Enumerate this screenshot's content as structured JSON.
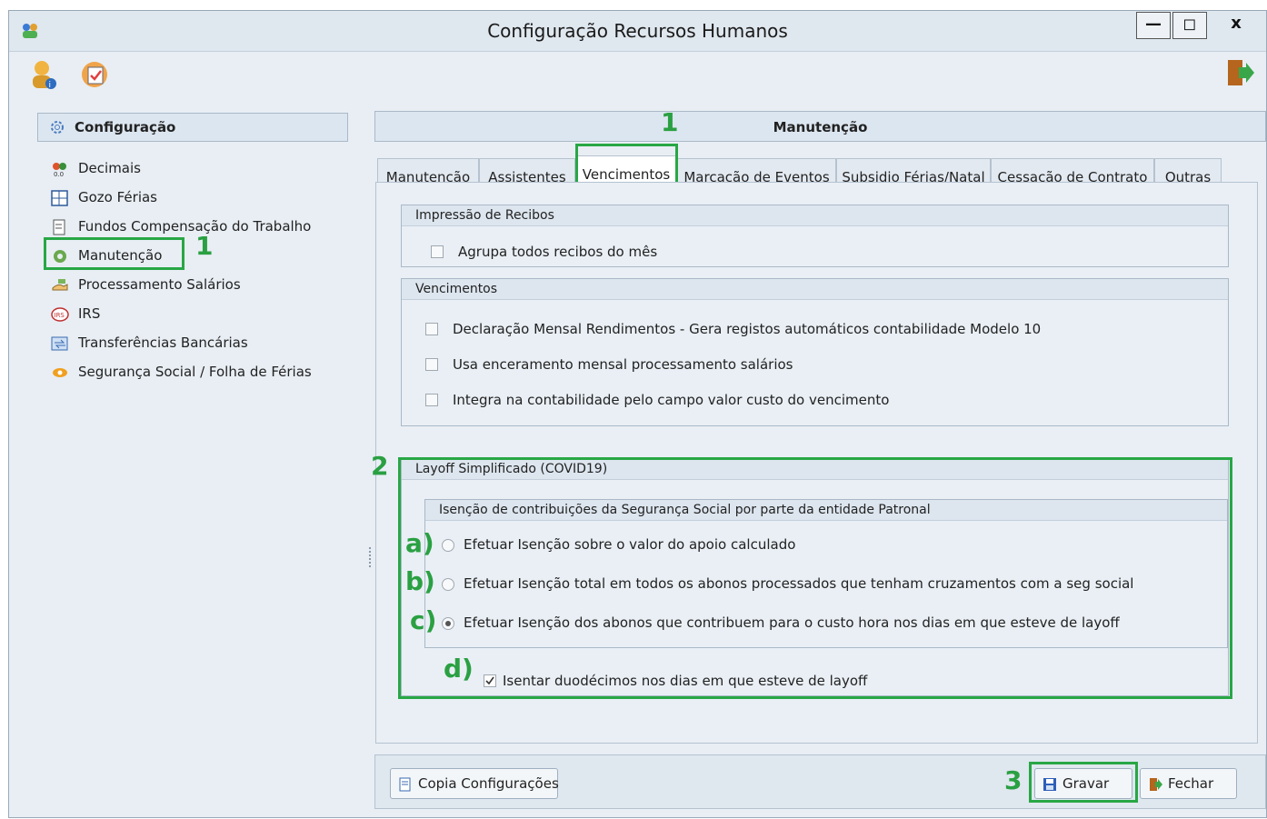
{
  "window": {
    "title": "Configuração Recursos Humanos",
    "controls": {
      "minimize": "—",
      "maximize": "◻",
      "close": "x"
    }
  },
  "left_panel": {
    "header": "Configuração",
    "items": [
      {
        "label": "Decimais",
        "icon": "decimals-icon"
      },
      {
        "label": "Gozo Férias",
        "icon": "calendar-grid-icon"
      },
      {
        "label": "Fundos Compensação do Trabalho",
        "icon": "document-icon"
      },
      {
        "label": "Manutenção",
        "icon": "gear-icon"
      },
      {
        "label": "Processamento Salários",
        "icon": "hand-money-icon"
      },
      {
        "label": "IRS",
        "icon": "irs-icon"
      },
      {
        "label": "Transferências Bancárias",
        "icon": "transfer-icon"
      },
      {
        "label": "Segurança Social / Folha de Férias",
        "icon": "eye-icon"
      }
    ]
  },
  "right_panel": {
    "header": "Manutenção",
    "tabs": [
      "Manutenção",
      "Assistentes",
      "Vencimentos",
      "Marcação de Eventos",
      "Subsidio Férias/Natal",
      "Cessação de Contrato",
      "Outras"
    ],
    "active_tab": "Vencimentos"
  },
  "groups": {
    "recibos": {
      "title": "Impressão de Recibos",
      "options": [
        {
          "label": "Agrupa todos recibos do mês",
          "checked": false
        }
      ]
    },
    "vencimentos": {
      "title": "Vencimentos",
      "options": [
        {
          "label": "Declaração Mensal Rendimentos - Gera registos automáticos contabilidade Modelo 10",
          "checked": false
        },
        {
          "label": "Usa enceramento mensal processamento salários",
          "checked": false
        },
        {
          "label": "Integra na contabilidade pelo campo valor custo do vencimento",
          "checked": false
        }
      ]
    },
    "layoff": {
      "title": "Layoff Simplificado (COVID19)",
      "sub_title": "Isenção de contribuições da Segurança Social por parte da entidade Patronal",
      "radios": [
        {
          "marker": "a)",
          "label": "Efetuar Isenção sobre o valor do apoio calculado",
          "selected": false
        },
        {
          "marker": "b)",
          "label": "Efetuar Isenção total em todos os abonos processados que tenham cruzamentos com a seg social",
          "selected": false
        },
        {
          "marker": "c)",
          "label": "Efetuar Isenção dos abonos que contribuem para o custo hora nos dias em que esteve de layoff",
          "selected": true
        }
      ],
      "extra": {
        "marker": "d)",
        "label": "Isentar duodécimos nos dias em que esteve de layoff",
        "checked": true
      }
    }
  },
  "footer": {
    "copy_button": "Copia Configurações",
    "save_button": "Gravar",
    "close_button": "Fechar"
  },
  "annotations": {
    "step1": "1",
    "step2": "2",
    "step3": "3"
  },
  "colors": {
    "highlight": "#28a745",
    "accent": "#2aa042"
  }
}
